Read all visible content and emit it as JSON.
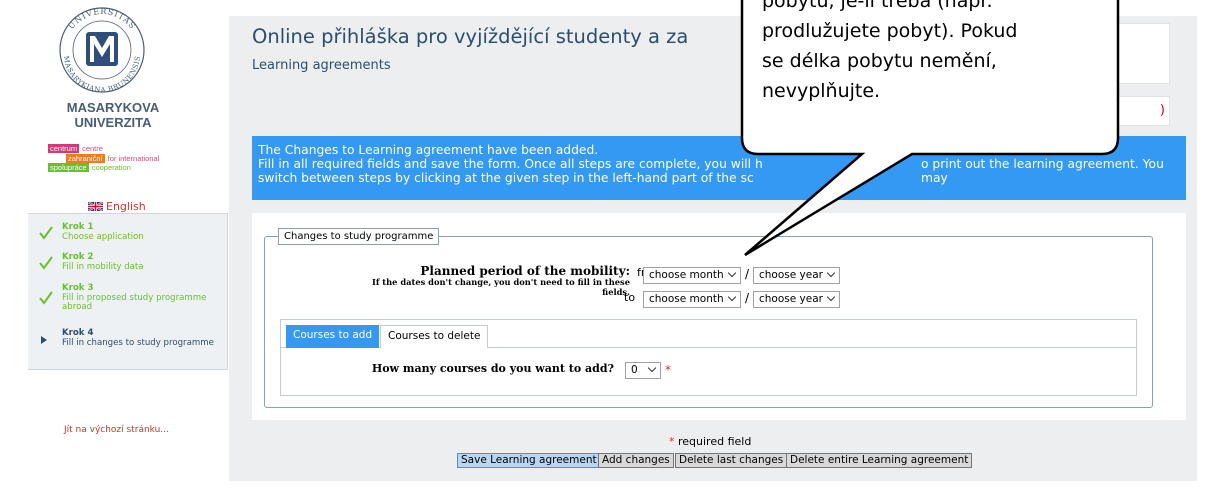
{
  "logo": {
    "seal_text_top": "UNIVERSITAS",
    "seal_text_bottom": "MASARYKIANA BRUNENSIS",
    "name_line1": "MASARYKOVA",
    "name_line2": "UNIVERZITA"
  },
  "cz_logo": {
    "row1_box": "centrum",
    "row1_sub": "centre",
    "row2_box": "zahraniční",
    "row2_sub": "for international",
    "row3_box": "spolupráce",
    "row3_sub": "cooperation",
    "colors": {
      "centrum": "#d6367a",
      "zahranicni": "#f07b1a",
      "spoluprace": "#6cbf2c"
    }
  },
  "language_link": "English",
  "steps": [
    {
      "title": "Krok 1",
      "desc": "Choose application",
      "state": "done"
    },
    {
      "title": "Krok 2",
      "desc": "Fill in mobility data",
      "state": "done"
    },
    {
      "title": "Krok 3",
      "desc": "Fill in proposed study programme abroad",
      "state": "done"
    },
    {
      "title": "Krok 4",
      "desc": "Fill in changes to study programme",
      "state": "current"
    }
  ],
  "home_link": "Jít na výchozí stránku...",
  "header": {
    "title": "Online přihláška pro vyjíždějící studenty a za",
    "subtitle": "Learning agreements",
    "box2_text": ")"
  },
  "notice": {
    "line1": "The Changes to Learning agreement have been added.",
    "line2": "Fill in all required fields and save the form. Once all steps are complete, you will h",
    "line2_end": "o print out the learning agreement. You may",
    "line3": "switch between steps by clicking at the given step in the left-hand part of the sc"
  },
  "form": {
    "legend": "Changes to study programme",
    "period_label": "Planned period of the mobility:",
    "period_hint_line1": "If the dates don't change, you don't need to fill in these",
    "period_hint_line2": "fields.",
    "from_label": "from",
    "to_label": "to",
    "month_placeholder": "choose month",
    "year_placeholder": "choose year",
    "separator": "/"
  },
  "tabs": [
    {
      "label": "Courses to add",
      "active": true
    },
    {
      "label": "Courses to delete",
      "active": false
    }
  ],
  "courses": {
    "label": "How many courses do you want to add?",
    "value": "0",
    "required_mark": "*"
  },
  "footer": {
    "required_star": "*",
    "required_text": " required field",
    "buttons": [
      "Save Learning agreement",
      "Add changes",
      "Delete last changes",
      "Delete entire Learning agreement"
    ]
  },
  "callout": {
    "lines": [
      "pobytu, je-li třeba (např.",
      "prodlužujete pobyt). Pokud",
      "se délka pobytu nemění,",
      "nevyplňujte."
    ]
  },
  "colors": {
    "accent_blue": "#3399f3",
    "title_blue": "#2d4d6e",
    "step_done_green": "#6abf2e",
    "link_red": "#c0392b",
    "required_red": "#e22b2b"
  }
}
